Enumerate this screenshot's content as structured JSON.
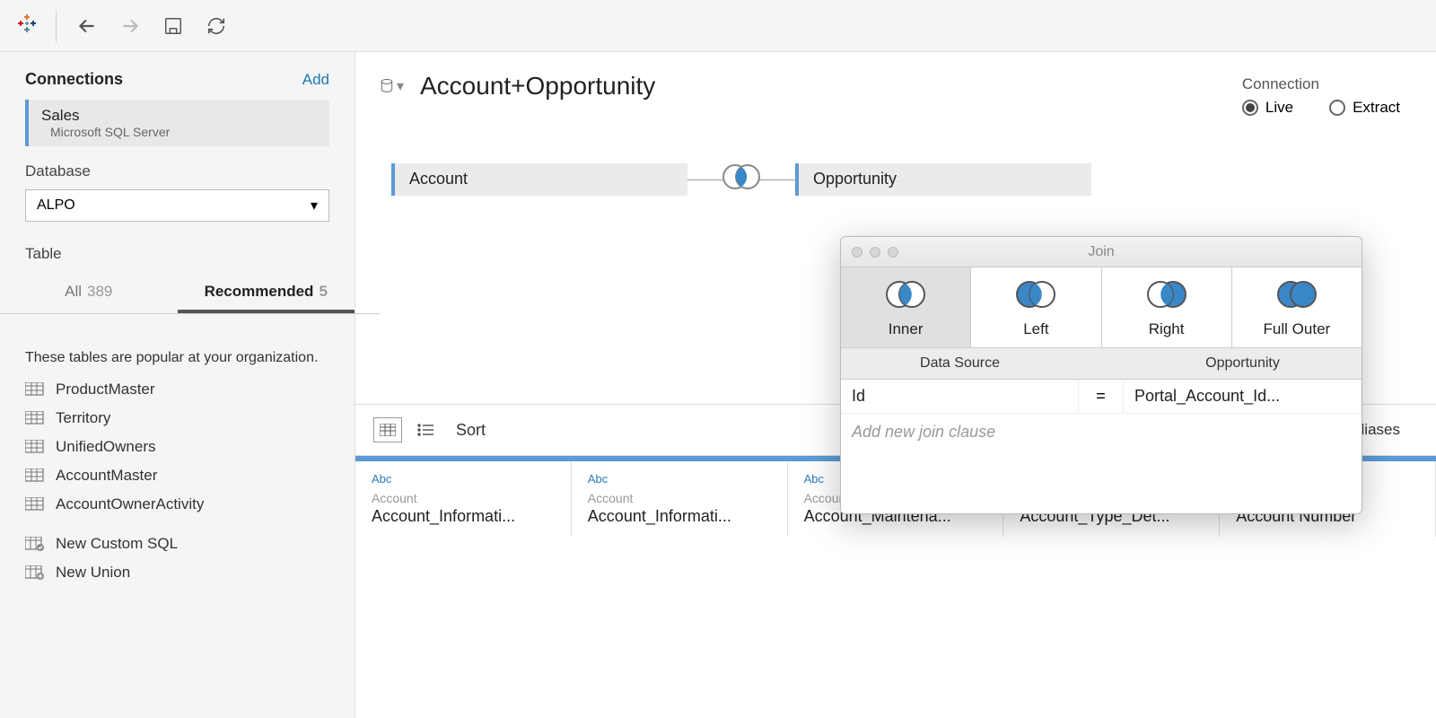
{
  "sidebar": {
    "connections_label": "Connections",
    "add_label": "Add",
    "connection": {
      "name": "Sales",
      "type": "Microsoft SQL Server"
    },
    "database_label": "Database",
    "database_value": "ALPO",
    "table_label": "Table",
    "tabs": {
      "all": "All",
      "all_count": "389",
      "rec": "Recommended",
      "rec_count": "5"
    },
    "tables_desc": "These tables are popular at your organization.",
    "tables": [
      "ProductMaster",
      "Territory",
      "UnifiedOwners",
      "AccountMaster",
      "AccountOwnerActivity"
    ],
    "new_sql": "New Custom SQL",
    "new_union": "New Union"
  },
  "datasource": {
    "title": "Account+Opportunity",
    "connection_label": "Connection",
    "live": "Live",
    "extract": "Extract",
    "table_left": "Account",
    "table_right": "Opportunity"
  },
  "join_popup": {
    "title": "Join",
    "types": [
      "Inner",
      "Left",
      "Right",
      "Full Outer"
    ],
    "header_left": "Data Source",
    "header_right": "Opportunity",
    "clause": {
      "left": "Id",
      "op": "=",
      "right": "Portal_Account_Id..."
    },
    "add_clause": "Add new join clause"
  },
  "data_toolbar": {
    "sort": "Sort",
    "show_aliases": "Show aliases"
  },
  "grid": {
    "type_label": "Abc",
    "source": "Account",
    "columns": [
      "Account_Informati...",
      "Account_Informati...",
      "Account_Maintena...",
      "Account_Type_Det...",
      "Account Number"
    ]
  }
}
